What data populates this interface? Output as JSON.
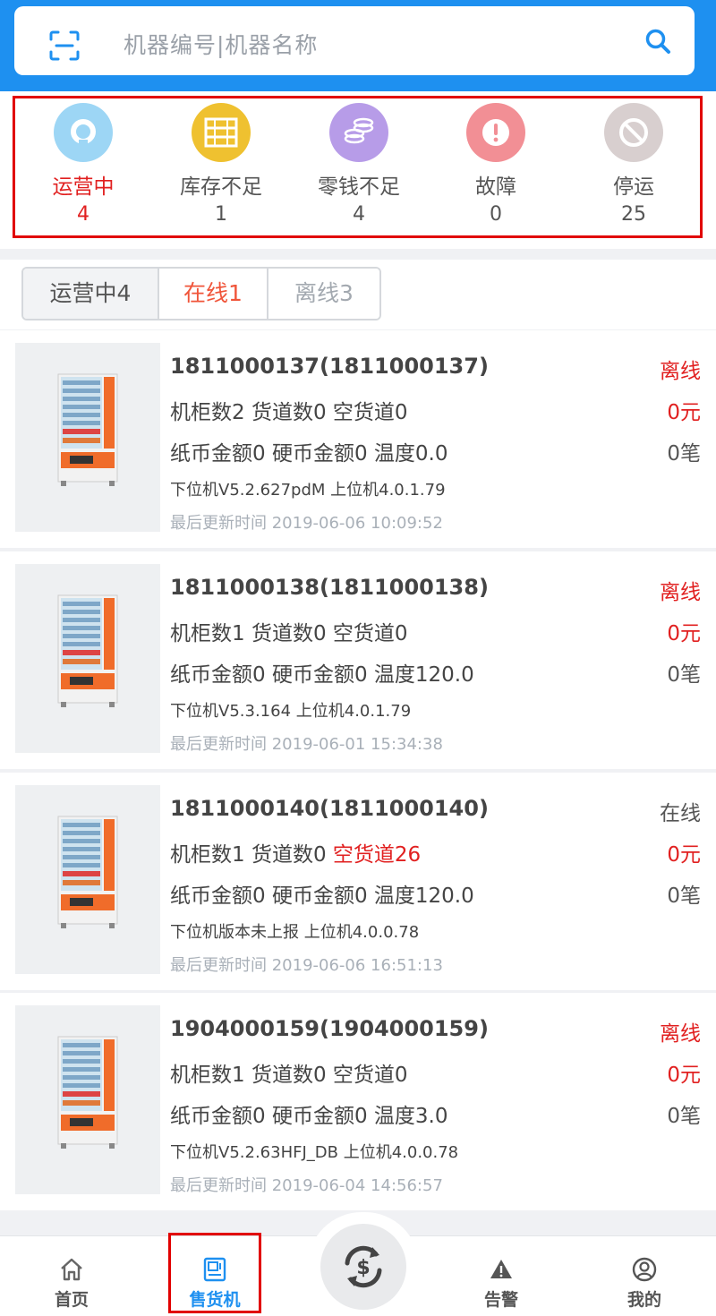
{
  "search": {
    "placeholder": "机器编号|机器名称"
  },
  "status": [
    {
      "label": "运营中",
      "count": "4",
      "icon": "operating-icon",
      "color": "#9dd6f5"
    },
    {
      "label": "库存不足",
      "count": "1",
      "icon": "inventory-icon",
      "color": "#efc130"
    },
    {
      "label": "零钱不足",
      "count": "4",
      "icon": "coins-icon",
      "color": "#b79ce8"
    },
    {
      "label": "故障",
      "count": "0",
      "icon": "fault-icon",
      "color": "#f28f95"
    },
    {
      "label": "停运",
      "count": "25",
      "icon": "stopped-icon",
      "color": "#d8cfcf"
    }
  ],
  "tabs": [
    {
      "label": "运营中4"
    },
    {
      "label": "在线1"
    },
    {
      "label": "离线3"
    }
  ],
  "machines": [
    {
      "title": "1811000137(1811000137)",
      "cabinet": "机柜数2 货道数0 空货道0",
      "money": "纸币金额0 硬币金额0 温度0.0",
      "version": "下位机V5.2.627pdM 上位机4.0.1.79",
      "updated": "最后更新时间 2019-06-06 10:09:52",
      "status": "离线",
      "amount": "0元",
      "orders": "0笔"
    },
    {
      "title": "1811000138(1811000138)",
      "cabinet": "机柜数1 货道数0 空货道0",
      "money": "纸币金额0 硬币金额0 温度120.0",
      "version": "下位机V5.3.164 上位机4.0.1.79",
      "updated": "最后更新时间 2019-06-01 15:34:38",
      "status": "离线",
      "amount": "0元",
      "orders": "0笔"
    },
    {
      "title": "1811000140(1811000140)",
      "cabinet_prefix": "机柜数1 货道数0 ",
      "cabinet_alert": "空货道26",
      "money": "纸币金额0 硬币金额0 温度120.0",
      "version": "下位机版本未上报 上位机4.0.0.78",
      "updated": "最后更新时间 2019-06-06 16:51:13",
      "status": "在线",
      "amount": "0元",
      "orders": "0笔"
    },
    {
      "title": "1904000159(1904000159)",
      "cabinet": "机柜数1 货道数0 空货道0",
      "money": "纸币金额0 硬币金额0 温度3.0",
      "version": "下位机V5.2.63HFJ_DB 上位机4.0.0.78",
      "updated": "最后更新时间 2019-06-04 14:56:57",
      "status": "离线",
      "amount": "0元",
      "orders": "0笔"
    }
  ],
  "nav": [
    {
      "label": "首页",
      "icon": "home-icon"
    },
    {
      "label": "售货机",
      "icon": "vending-machine-icon"
    },
    {
      "label": "",
      "icon": "exchange-icon"
    },
    {
      "label": "告警",
      "icon": "warning-icon"
    },
    {
      "label": "我的",
      "icon": "user-icon"
    }
  ],
  "colors": {
    "accent": "#1e90f0",
    "alert": "#e12020",
    "online_tab": "#f0553a"
  }
}
